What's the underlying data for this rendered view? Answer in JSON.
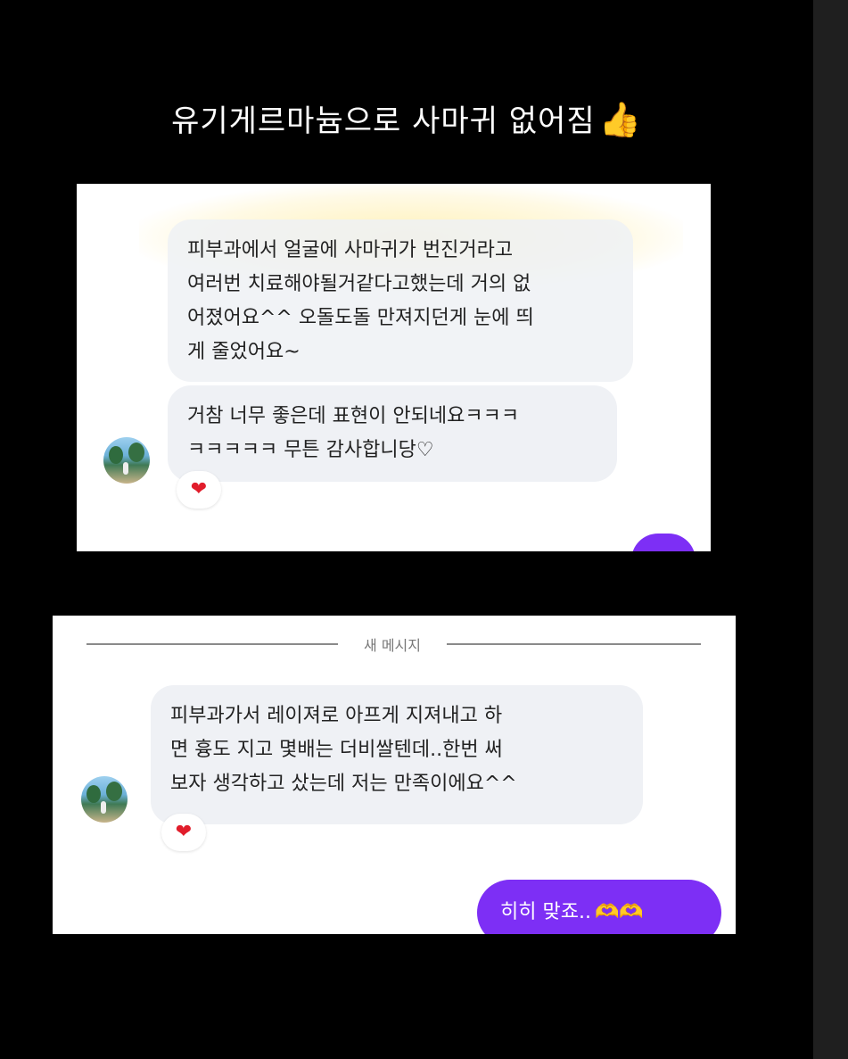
{
  "headline": {
    "text": "유기게르마늄으로 사마귀 없어짐",
    "emoji": "👍"
  },
  "screenshot1": {
    "message1": [
      "피부과에서 얼굴에 사마귀가 번진거라고",
      "여러번 치료해야될거같다고했는데 거의 없",
      "어졌어요^^ 오돌도돌 만져지던게 눈에 띄",
      "게 줄었어요~"
    ],
    "message2": [
      "거참 너무 좋은데 표현이 안되네요ㅋㅋㅋ",
      "ㅋㅋㅋㅋㅋ 무튼 감사합니당♡"
    ],
    "reaction": "❤"
  },
  "screenshot2": {
    "divider_label": "새 메시지",
    "message": [
      "피부과가서 레이져로 아프게 지져내고 하",
      "면 흉도 지고 몇배는 더비쌀텐데..한번 써",
      "보자 생각하고 샀는데 저는 만족이에요^^"
    ],
    "reaction": "❤",
    "sent_text": "히히 맞죠..",
    "sent_emoji": "🫶🫶"
  },
  "colors": {
    "sent_bubble": "#7d2ff5",
    "received_bubble": "#eff1f5",
    "background": "#000000"
  }
}
